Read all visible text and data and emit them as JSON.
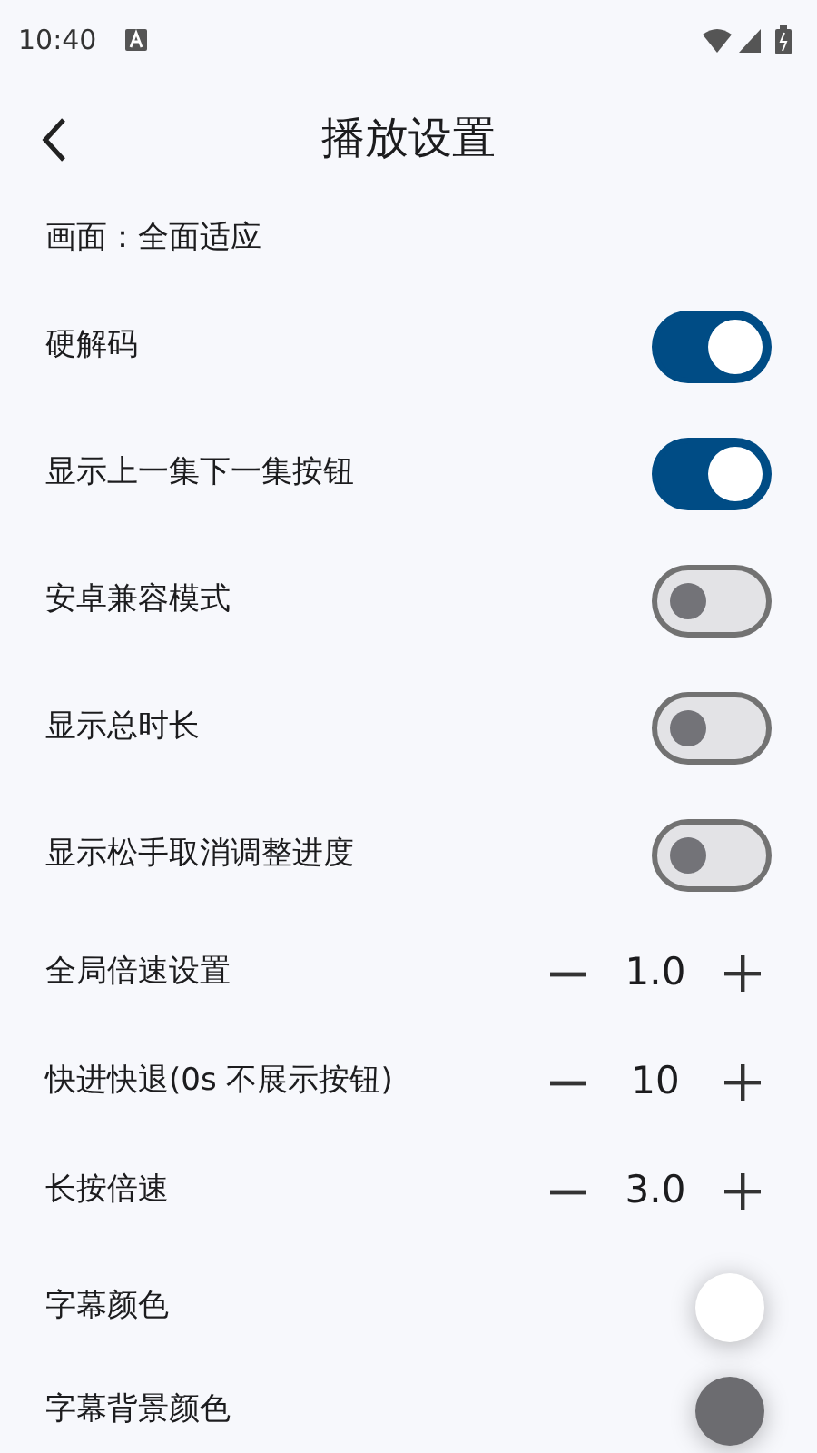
{
  "status_bar": {
    "time": "10:40"
  },
  "header": {
    "title": "播放设置"
  },
  "settings": [
    {
      "kind": "text",
      "label": "画面：全面适应"
    },
    {
      "kind": "toggle",
      "label": "硬解码",
      "on": true
    },
    {
      "kind": "toggle",
      "label": "显示上一集下一集按钮",
      "on": true
    },
    {
      "kind": "toggle",
      "label": "安卓兼容模式",
      "on": false
    },
    {
      "kind": "toggle",
      "label": "显示总时长",
      "on": false
    },
    {
      "kind": "toggle",
      "label": "显示松手取消调整进度",
      "on": false
    },
    {
      "kind": "stepper",
      "label": "全局倍速设置",
      "value": "1.0"
    },
    {
      "kind": "stepper",
      "label": "快进快退(0s 不展示按钮)",
      "value": "10"
    },
    {
      "kind": "stepper",
      "label": "长按倍速",
      "value": "3.0"
    },
    {
      "kind": "color",
      "label": "字幕颜色",
      "color": "#ffffff"
    },
    {
      "kind": "color",
      "label": "字幕背景颜色",
      "color": "#6c6c70"
    }
  ]
}
